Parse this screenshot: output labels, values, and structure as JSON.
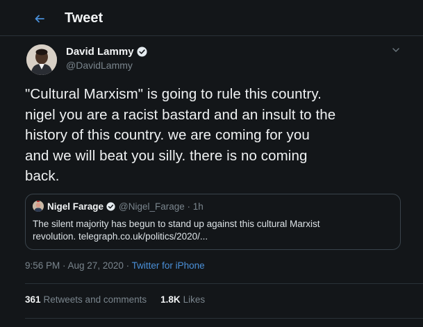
{
  "header": {
    "title": "Tweet",
    "back_icon": "arrow-left-icon"
  },
  "author": {
    "name": "David Lammy",
    "handle": "@DavidLammy",
    "verified_icon": "verified-badge-icon",
    "menu_icon": "chevron-down-icon"
  },
  "tweet": {
    "lines": [
      "\"Cultural Marxism\" is going to rule this country.",
      "nigel you are a racist bastard and an insult to the",
      "history of this country. we are coming for you",
      "and we will beat you silly. there is no coming",
      "back."
    ]
  },
  "quoted": {
    "name": "Nigel Farage",
    "handle_time": "@Nigel_Farage · 1h",
    "text_lines": [
      "The silent majority has begun to stand up against this cultural Marxist",
      "revolution. telegraph.co.uk/politics/2020/..."
    ]
  },
  "meta": {
    "datetime": "9:56 PM · Aug 27, 2020 · ",
    "client": "Twitter for iPhone"
  },
  "stats": {
    "retweets_count": "361",
    "retweets_label": "Retweets and comments",
    "likes_count": "1.8K",
    "likes_label": "Likes"
  },
  "colors": {
    "background": "#131619",
    "accent": "#4a90d9",
    "verified": "#e6ecf0"
  }
}
